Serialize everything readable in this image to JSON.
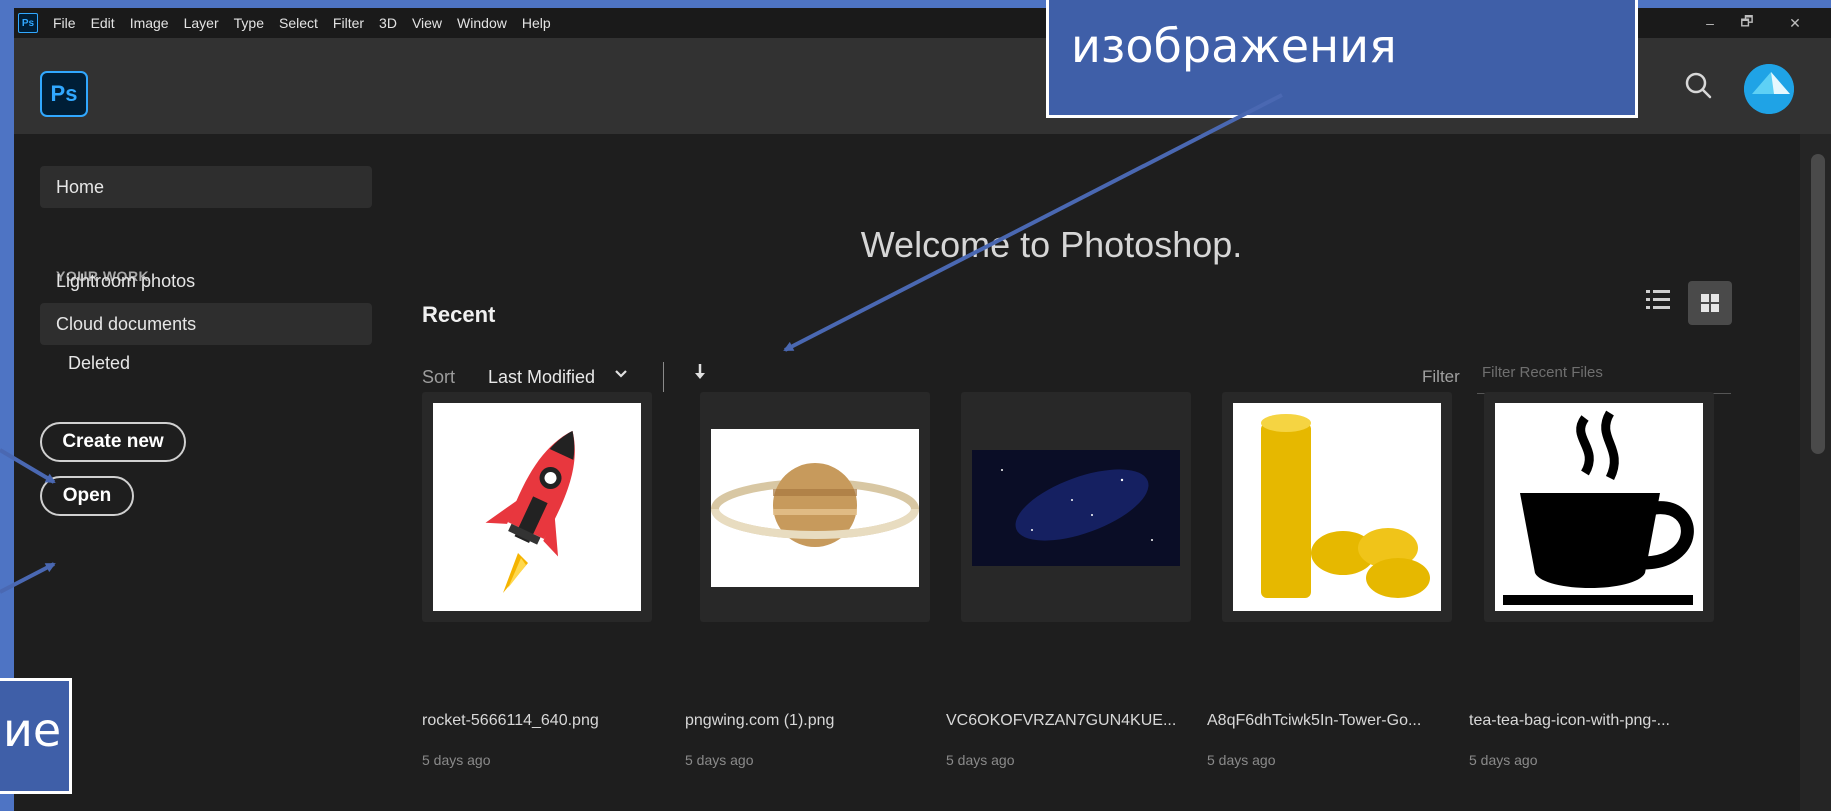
{
  "app": {
    "mini_logo": "Ps",
    "logo": "Ps"
  },
  "menu": [
    "File",
    "Edit",
    "Image",
    "Layer",
    "Type",
    "Select",
    "Filter",
    "3D",
    "View",
    "Window",
    "Help"
  ],
  "window_controls": {
    "minimize": "–",
    "restore": "🗗",
    "close": "✕"
  },
  "sidebar": {
    "home": "Home",
    "section": "YOUR WORK",
    "lightroom": "Lightroom photos",
    "cloud": "Cloud documents",
    "deleted": "Deleted",
    "create_new": "Create new",
    "open": "Open"
  },
  "main": {
    "welcome": "Welcome to Photoshop.",
    "recent": "Recent",
    "sort_label": "Sort",
    "sort_value": "Last Modified",
    "filter_label": "Filter",
    "filter_placeholder": "Filter Recent Files"
  },
  "files": [
    {
      "name": "rocket-5666114_640.png",
      "date": "5 days ago"
    },
    {
      "name": "pngwing.com (1).png",
      "date": "5 days ago"
    },
    {
      "name": "VC6OKOFVRZAN7GUN4KUE...",
      "date": "5 days ago"
    },
    {
      "name": "A8qF6dhTciwk5In-Tower-Go...",
      "date": "5 days ago"
    },
    {
      "name": "tea-tea-bag-icon-with-png-...",
      "date": "5 days ago"
    }
  ],
  "callouts": {
    "top": "изображения",
    "bottom": "ие"
  },
  "colors": {
    "accent": "#31a8ff",
    "callout": "#3f5fa8",
    "background": "#4e74c4"
  }
}
